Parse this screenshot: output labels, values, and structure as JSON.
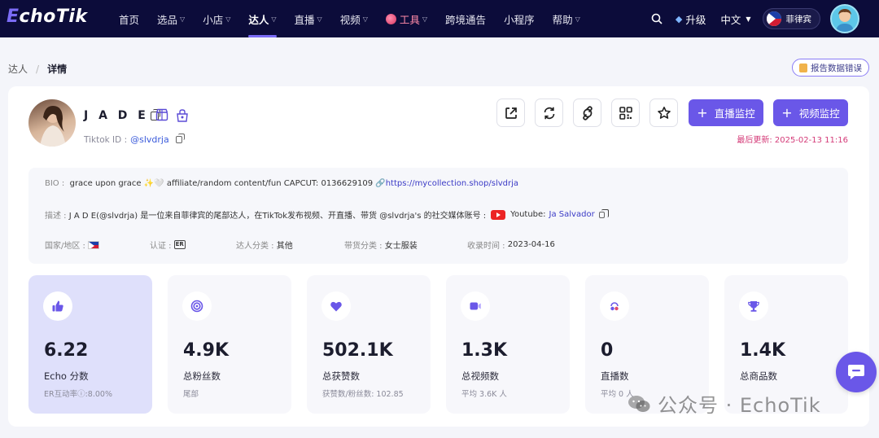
{
  "nav": {
    "logo_prefix": "E",
    "logo_rest": "choTik",
    "items": [
      {
        "label": "首页",
        "chevron": false
      },
      {
        "label": "选品",
        "chevron": true
      },
      {
        "label": "小店",
        "chevron": true
      },
      {
        "label": "达人",
        "chevron": true,
        "active": true
      },
      {
        "label": "直播",
        "chevron": true
      },
      {
        "label": "视频",
        "chevron": true
      },
      {
        "label": "工具",
        "chevron": true
      },
      {
        "label": "跨境通告",
        "chevron": false
      },
      {
        "label": "小程序",
        "chevron": false
      },
      {
        "label": "帮助",
        "chevron": true
      }
    ],
    "upgrade": "升级",
    "language": "中文",
    "country": "菲律宾"
  },
  "breadcrumb": {
    "parent": "达人",
    "separator": "/",
    "current": "详情"
  },
  "report_button": "报告数据错误",
  "profile": {
    "name": "J A D E",
    "tiktok_label": "Tiktok ID :",
    "handle": "@slvdrja",
    "updated": "最后更新: 2025-02-13 11:16",
    "live_monitor": "直播监控",
    "video_monitor": "视频监控"
  },
  "info": {
    "bio_label": "BIO :",
    "bio_text": "grace upon grace ✨🤍 affiliate/random content/fun CAPCUT: 0136629109 🔗",
    "bio_link": "https://mycollection.shop/slvdrja",
    "desc_label": "描述 :",
    "desc_text": "J A D E(@slvdrja) 是一位来自菲律宾的尾部达人，在TikTok发布视频、开直播、带货 @slvdrja's 的社交媒体账号 :",
    "youtube_label": "Youtube:",
    "youtube_name": "Ja Salvador",
    "country_label": "国家/地区 :",
    "cert_label": "认证 :",
    "cert_badge": "ER",
    "category_label": "达人分类 :",
    "category_value": "其他",
    "goods_label": "带货分类 :",
    "goods_value": "女士服装",
    "collected_label": "收录时间 :",
    "collected_value": "2023-04-16"
  },
  "stats": [
    {
      "value": "6.22",
      "label": "Echo 分数",
      "sub": "ER互动率ⓘ:8.00%",
      "icon": "thumbs-up-icon"
    },
    {
      "value": "4.9K",
      "label": "总粉丝数",
      "sub": "尾部",
      "icon": "target-icon"
    },
    {
      "value": "502.1K",
      "label": "总获赞数",
      "sub": "获赞数/粉丝数: 102.85",
      "icon": "heart-icon"
    },
    {
      "value": "1.3K",
      "label": "总视频数",
      "sub": "平均 3.6K 人",
      "icon": "video-icon"
    },
    {
      "value": "0",
      "label": "直播数",
      "sub": "平均 0 人",
      "icon": "live-icon"
    },
    {
      "value": "1.4K",
      "label": "总商品数",
      "sub": "",
      "icon": "trophy-icon"
    }
  ],
  "watermark": "公众号 · EchoTik",
  "colors": {
    "nav_bg": "#0c0c3a",
    "accent": "#6a57e8",
    "updated": "#d43b78",
    "link": "#3b3bc6"
  }
}
